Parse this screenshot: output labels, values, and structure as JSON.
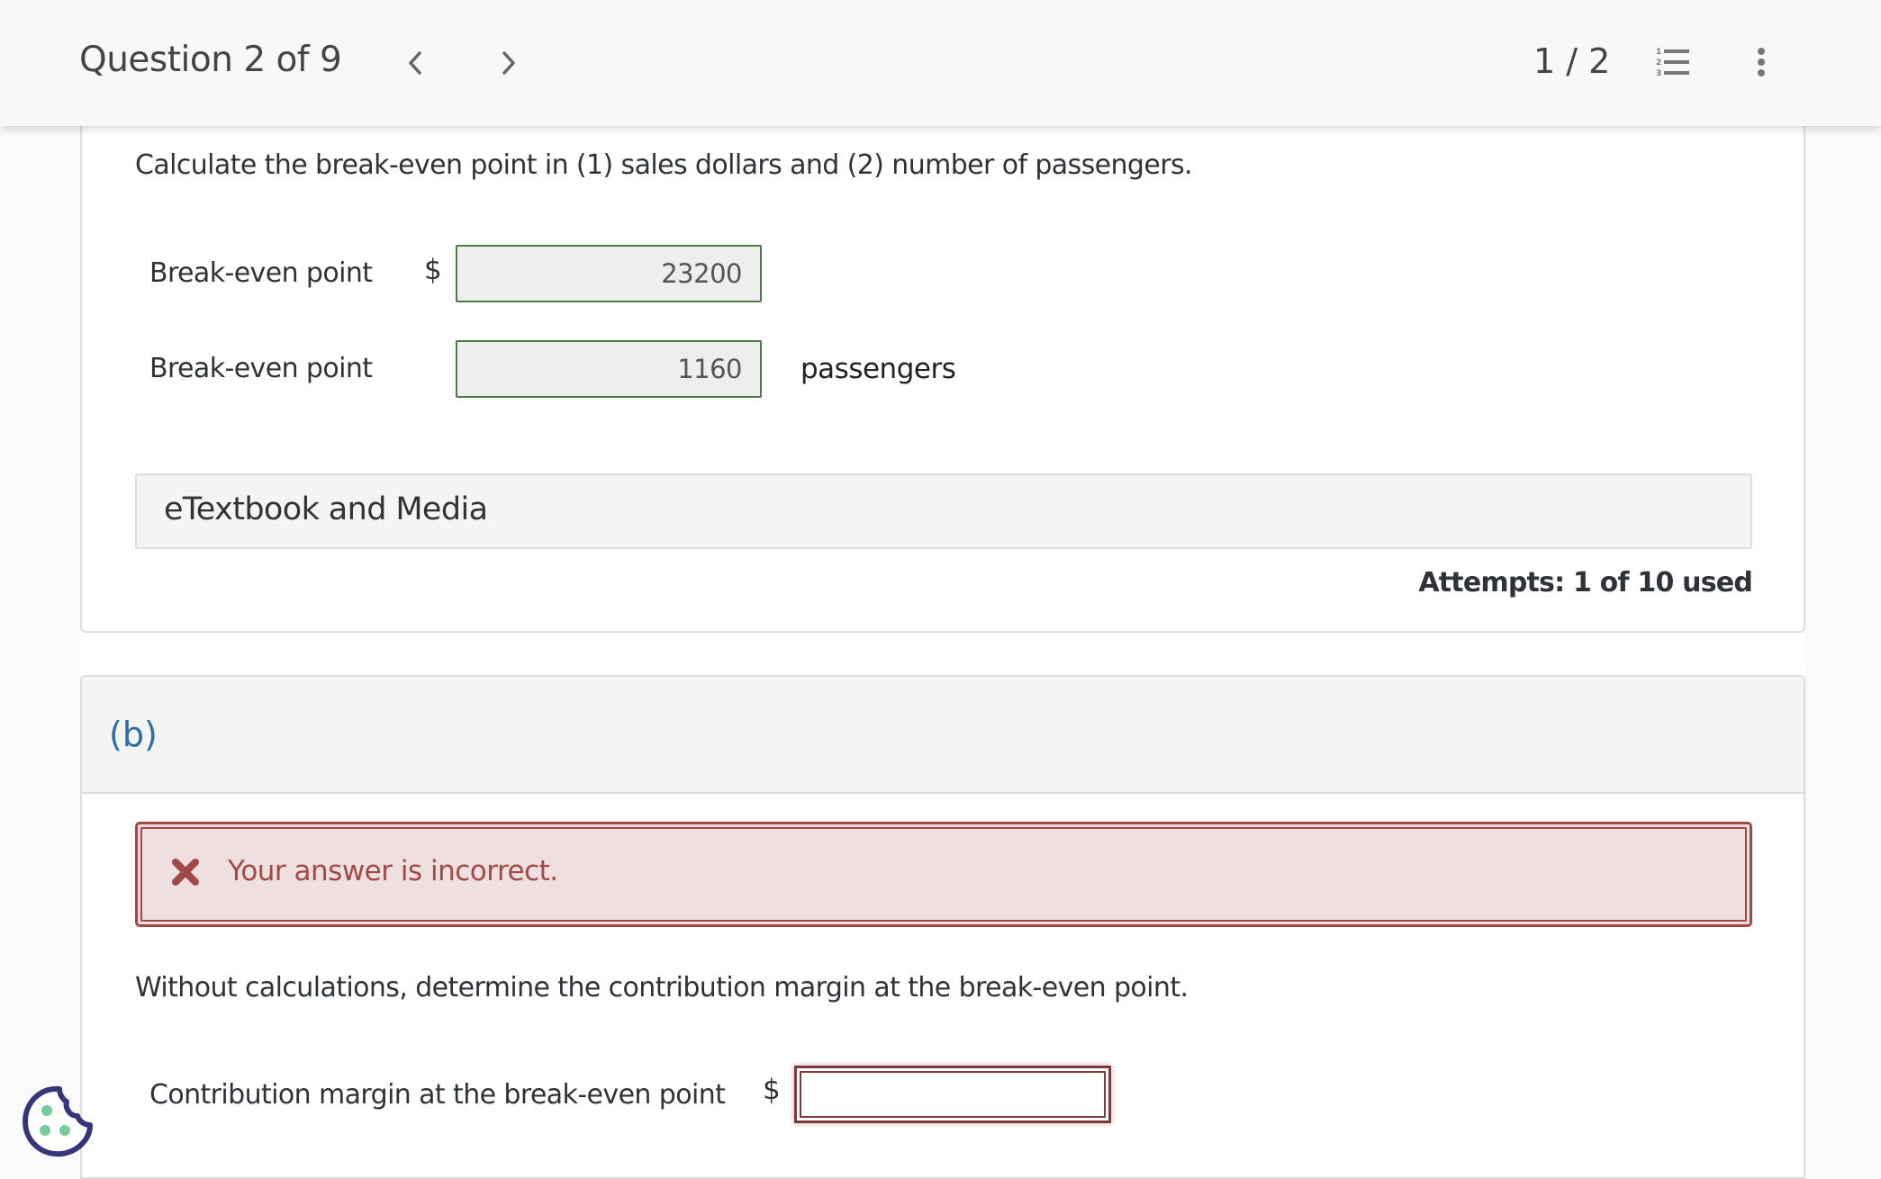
{
  "header": {
    "question_position": "Question 2 of 9",
    "prev_icon": "chevron-left-icon",
    "next_icon": "chevron-right-icon",
    "page_count": "1 / 2",
    "list_icon": "numbered-list-icon",
    "more_icon": "more-vertical-icon"
  },
  "part_a": {
    "prompt": "Calculate the break-even point in (1) sales dollars and (2) number of passengers.",
    "rows": [
      {
        "label": "Break-even point",
        "prefix": "$",
        "value": "23200",
        "suffix": ""
      },
      {
        "label": "Break-even point",
        "prefix": "",
        "value": "1160",
        "suffix": "passengers"
      }
    ],
    "etextbook_label": "eTextbook and Media",
    "attempts": "Attempts: 1 of 10 used"
  },
  "part_b": {
    "label": "(b)",
    "feedback": {
      "icon": "x-icon",
      "text": "Your answer is incorrect."
    },
    "prompt": "Without calculations, determine the contribution margin at the break-even point.",
    "field": {
      "label": "Contribution margin at the break-even point",
      "prefix": "$",
      "value": ""
    }
  },
  "colors": {
    "correct_border": "#4d7a45",
    "incorrect_border": "#a04a47",
    "incorrect_bg": "#efdfdf",
    "part_label": "#2a6ea6"
  },
  "cookie_icon": "cookie-icon"
}
